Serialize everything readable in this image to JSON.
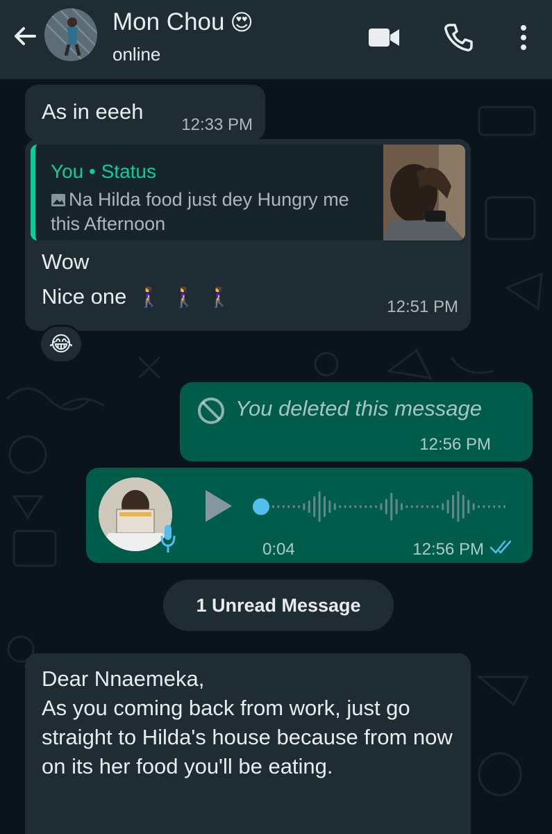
{
  "header": {
    "contact_name": "Mon Chou",
    "name_emoji": "😍",
    "status": "online",
    "icons": [
      "back-arrow-icon",
      "video-call-icon",
      "voice-call-icon",
      "more-options-icon"
    ]
  },
  "messages": {
    "m1": {
      "text": "As in eeeh",
      "time": "12:33 PM"
    },
    "m2": {
      "quote_title": "You • Status",
      "quote_text": "Na Hilda food just dey Hungry me this Afternoon",
      "line1": "Wow",
      "line2": "Nice one",
      "line2_emojis": "🚶‍♀️ 🚶‍♀️ 🚶‍♀️",
      "time": "12:51 PM",
      "reaction": "😂"
    },
    "m3": {
      "text": "You deleted this message",
      "time": "12:56 PM"
    },
    "m4": {
      "duration": "0:04",
      "time": "12:56 PM",
      "progress": 0
    },
    "unread": "1 Unread Message",
    "m5": {
      "text": "Dear Nnaemeka,\nAs you coming back from work, just go straight to Hilda's house because from now on its her food you'll be eating."
    }
  },
  "colors": {
    "header_bg": "#1f2c34",
    "chat_bg": "#0b141a",
    "incoming_bubble": "#1f2c34",
    "outgoing_bubble": "#005c4b",
    "accent_green": "#06cf9c",
    "voice_dot": "#53bdeb"
  }
}
